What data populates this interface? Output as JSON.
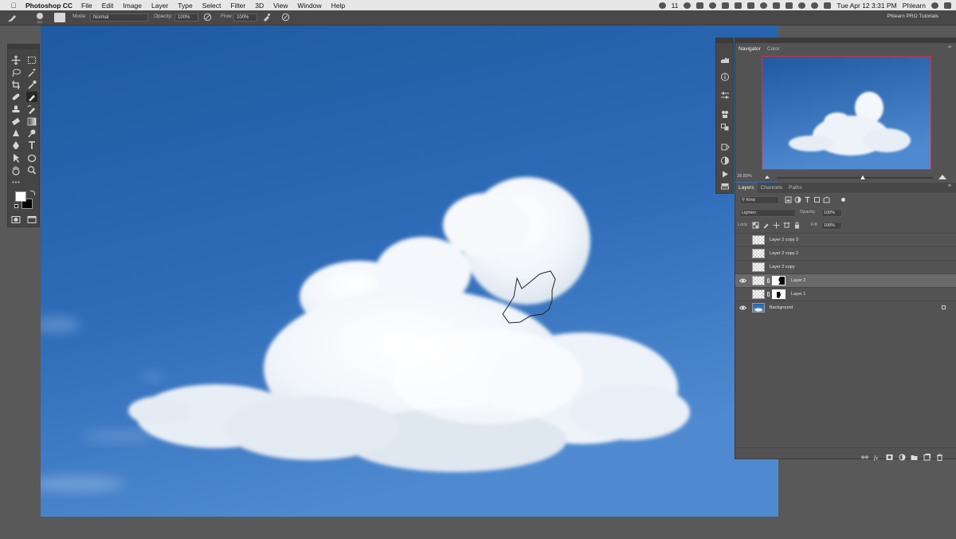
{
  "menubar": {
    "apple_icon": "apple-icon",
    "app_name": "Photoshop CC",
    "items": [
      "File",
      "Edit",
      "Image",
      "Layer",
      "Type",
      "Select",
      "Filter",
      "3D",
      "View",
      "Window",
      "Help"
    ],
    "status_count": "11",
    "clock": "Tue Apr 12  3:31 PM",
    "user": "Phlearn"
  },
  "options_bar": {
    "brush_size": "150",
    "mode_label": "Mode:",
    "mode_value": "Normal",
    "opacity_label": "Opacity:",
    "opacity_value": "100%",
    "flow_label": "Flow:",
    "flow_value": "100%",
    "workspace": "Phlearn PRO Tutorials"
  },
  "navigator": {
    "tabs": [
      "Navigator",
      "Color"
    ],
    "zoom": "28.89%",
    "view_fraction": 0.55
  },
  "layers_panel": {
    "tabs": [
      "Layers",
      "Channels",
      "Paths"
    ],
    "filter_kind": "Kind",
    "blend_mode": "Lighten",
    "opacity_label": "Opacity:",
    "opacity_value": "100%",
    "lock_label": "Lock:",
    "fill_label": "Fill:",
    "fill_value": "100%",
    "layers": [
      {
        "name": "Layer 2 copy 3",
        "visible": false,
        "has_mask": false,
        "selected": false
      },
      {
        "name": "Layer 2 copy 2",
        "visible": false,
        "has_mask": false,
        "selected": false
      },
      {
        "name": "Layer 2 copy",
        "visible": false,
        "has_mask": false,
        "selected": false
      },
      {
        "name": "Layer 2",
        "visible": true,
        "has_mask": true,
        "selected": true
      },
      {
        "name": "Layer 1",
        "visible": false,
        "has_mask": true,
        "selected": false
      },
      {
        "name": "Background",
        "visible": true,
        "has_mask": false,
        "selected": false,
        "locked": true
      }
    ]
  },
  "colors": {
    "sky_top": "#1f5aa0",
    "sky_bottom": "#4f8ad0",
    "panel": "#535353",
    "navigator_frame": "#f02525"
  }
}
